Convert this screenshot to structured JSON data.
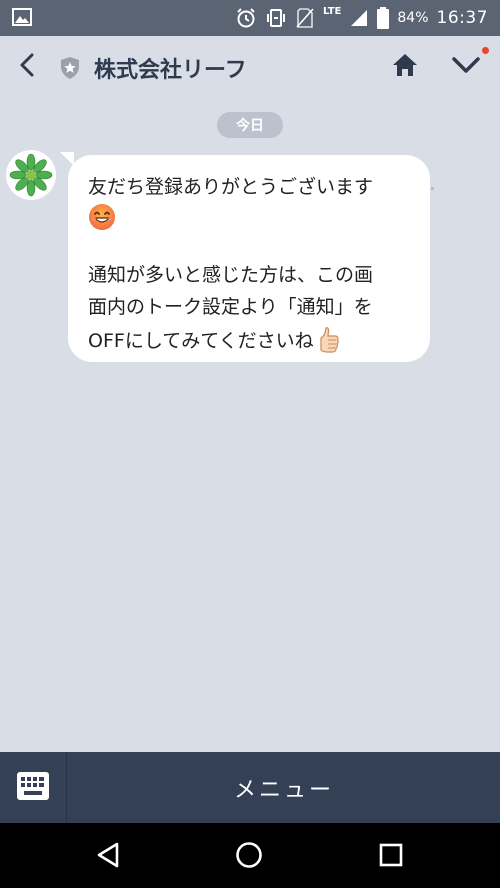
{
  "status_bar": {
    "battery_percent": "84%",
    "network": "LTE",
    "time": "16:37",
    "icons": [
      "image-icon",
      "alarm-icon",
      "vibrate-icon",
      "no-sim-icon",
      "lte-icon",
      "signal-icon",
      "battery-icon"
    ]
  },
  "header": {
    "title": "株式会社リーフ",
    "back_icon": "chevron-left-icon",
    "verified_icon": "shield-star-icon",
    "home_icon": "home-icon",
    "menu_icon": "chevron-down-icon",
    "notification_dot_color": "#e8452c"
  },
  "chat": {
    "date_label": "今日",
    "message": {
      "line1": "友だち登録ありがとうございます",
      "line2_emoji": "grinning-face-emoji",
      "line3": "通知が多いと感じた方は、この画",
      "line4": "面内のトーク設定より「通知」を",
      "line5": "OFFにしてみてくださいね",
      "line5_emoji": "thumbs-up-emoji"
    }
  },
  "bottom_bar": {
    "keyboard_icon": "keyboard-icon",
    "menu_label": "メニュー"
  },
  "nav_bar": {
    "back_icon": "back-triangle-icon",
    "home_icon": "home-circle-icon",
    "recents_icon": "recents-square-icon"
  },
  "colors": {
    "chat_background": "#d9dde6",
    "status_bar": "#5b6472",
    "bottom_bar": "#334055",
    "header_text": "#2e3a4e",
    "date_pill": "#bcc2cd"
  }
}
